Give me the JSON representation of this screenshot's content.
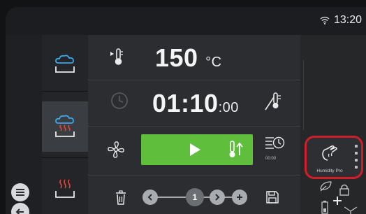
{
  "status": {
    "time": "13:20",
    "wifi_icon": "wifi-icon"
  },
  "modes": [
    {
      "name": "steam-mode",
      "icon": "steam-cloud-icon",
      "color": "#3aa7e8",
      "active": false
    },
    {
      "name": "combi-mode",
      "icon": "combi-cloud-heat-icon",
      "color": "#3aa7e8",
      "accent": "#e2453a",
      "active": true
    },
    {
      "name": "hot-air-mode",
      "icon": "hot-air-icon",
      "color": "#e2453a",
      "active": false
    }
  ],
  "temperature": {
    "value": "150",
    "unit": "°C"
  },
  "timer": {
    "main": "01:10",
    "seconds": ":00"
  },
  "start": {
    "color": "#5fbe3c"
  },
  "preheat_timer": {
    "label": "00:00"
  },
  "program_nav": {
    "page": "1"
  },
  "humidity_pro": {
    "label": "Humidity Pro",
    "highlight": "#d21e2a"
  },
  "colors": {
    "panel": "#2b2d30",
    "icon": "#dfe2e5"
  }
}
